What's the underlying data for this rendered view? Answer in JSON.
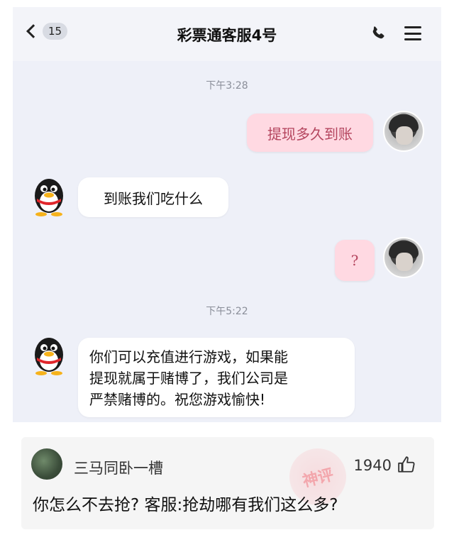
{
  "header": {
    "back_count": "15",
    "title": "彩票通客服4号"
  },
  "messages": [
    {
      "type": "time",
      "text": "下午3:28"
    },
    {
      "type": "sent",
      "text": "提现多久到账"
    },
    {
      "type": "received",
      "text": "到账我们吃什么"
    },
    {
      "type": "sent",
      "text": "?"
    },
    {
      "type": "time",
      "text": "下午5:22"
    },
    {
      "type": "received",
      "lines": [
        "你们可以充值进行游戏，如果能",
        "提现就属于赌博了，我们公司是",
        "严禁赌博的。祝您游戏愉快!"
      ]
    }
  ],
  "comment": {
    "username": "三马同卧一槽",
    "likes": "1940",
    "text": "你怎么不去抢? 客服:抢劫哪有我们这么多?",
    "badge": "神评"
  },
  "colors": {
    "chat_bg": "#eef0f8",
    "sent_bubble": "#ffd9e2",
    "sent_text": "#b4455e",
    "received_bubble": "#ffffff"
  }
}
